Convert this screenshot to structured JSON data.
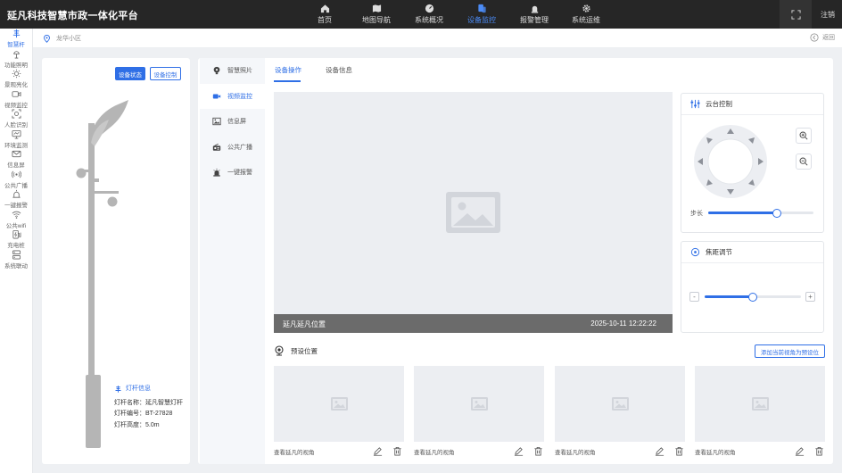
{
  "header": {
    "title": "延凡科技智慧市政一体化平台",
    "nav": [
      "首页",
      "地图导航",
      "系统概况",
      "设备监控",
      "报警管理",
      "系统运维"
    ],
    "active_nav": "设备监控",
    "logout_label": "注销"
  },
  "sidebar": {
    "items": [
      {
        "label": "智慧杆",
        "icon": "pole-icon",
        "active": true
      },
      {
        "label": "功能照明",
        "icon": "lamp-icon"
      },
      {
        "label": "景观亮化",
        "icon": "sun-icon"
      },
      {
        "label": "视频监控",
        "icon": "video-camera-icon"
      },
      {
        "label": "人脸识别",
        "icon": "face-scan-icon"
      },
      {
        "label": "环境监测",
        "icon": "monitor-icon"
      },
      {
        "label": "信息屏",
        "icon": "mail-icon"
      },
      {
        "label": "公共广播",
        "icon": "broadcast-icon"
      },
      {
        "label": "一键报警",
        "icon": "alarm-icon"
      },
      {
        "label": "公共wifi",
        "icon": "wifi-icon"
      },
      {
        "label": "充电桩",
        "icon": "charger-icon"
      },
      {
        "label": "系统联动",
        "icon": "link-icon"
      }
    ]
  },
  "breadcrumb": {
    "location": "龙华小区",
    "back_label": "返回"
  },
  "pole_panel": {
    "status_button": "设备状态",
    "control_button": "设备控制",
    "info_title": "灯杆信息",
    "info_rows": [
      "灯杆名称：延凡智慧灯杆",
      "灯杆编号：BT-27828",
      "灯杆高度：5.0m"
    ]
  },
  "device_menu": {
    "items": [
      "智慧照片",
      "视频监控",
      "信息屏",
      "公共广播",
      "一键报警"
    ],
    "active": "视频监控"
  },
  "tabs": {
    "items": [
      "设备操作",
      "设备信息"
    ],
    "active": "设备操作"
  },
  "video": {
    "location": "延凡延凡位置",
    "timestamp": "2025-10-11  12:22:22"
  },
  "ptz": {
    "title": "云台控制",
    "step_label": "步长",
    "step_value": 0.65
  },
  "focus": {
    "title": "焦距调节",
    "minus": "-",
    "plus": "+",
    "value": 0.5
  },
  "presets": {
    "title": "预设位置",
    "add_button": "添加当前视角为预设位",
    "items": [
      "查看延凡的视角",
      "查看延凡的视角",
      "查看延凡的视角",
      "查看延凡的视角"
    ]
  },
  "colors": {
    "accent": "#2f6fe6",
    "header_bg": "#262626"
  }
}
